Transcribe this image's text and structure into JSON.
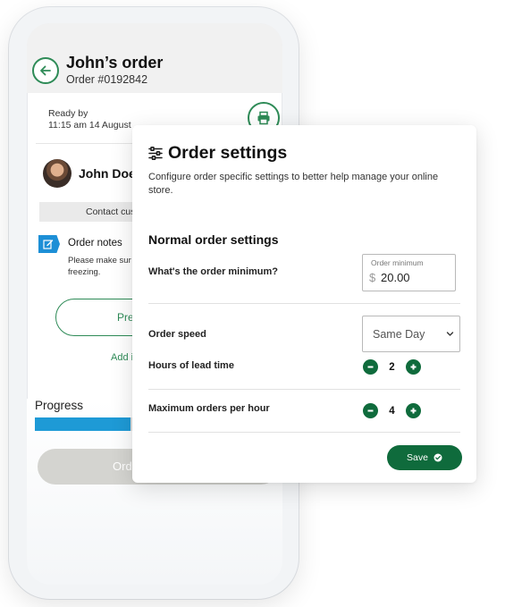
{
  "phone": {
    "title": "John’s order",
    "order_number": "Order #0192842",
    "ready_label": "Ready by",
    "ready_time": "11:15 am  14 August",
    "customer_name": "John Doe",
    "contact_button": "Contact cus",
    "notes_title": "Order notes",
    "notes_text": "Please make sur freezing.",
    "prep_button": "Prep",
    "add_link": "Add i",
    "progress_label": "Progress",
    "progress_fraction": 0.4,
    "order_button": "Ord",
    "colors": {
      "accent_green": "#2e8b57",
      "progress_blue": "#1e9ad6",
      "notes_blue": "#1d8fd6"
    }
  },
  "settings": {
    "title": "Order settings",
    "description": "Configure order specific settings to better help manage your online store.",
    "section_title": "Normal order settings",
    "order_minimum": {
      "label": "What's the order minimum?",
      "caption": "Order minimum",
      "currency": "$",
      "value": "20.00"
    },
    "order_speed": {
      "label": "Order speed",
      "selected": "Same Day"
    },
    "lead_time": {
      "label": "Hours of lead time",
      "value": "2"
    },
    "max_orders": {
      "label": "Maximum orders per hour",
      "value": "4"
    },
    "save_label": "Save",
    "colors": {
      "button_green": "#0f6b3c"
    }
  }
}
